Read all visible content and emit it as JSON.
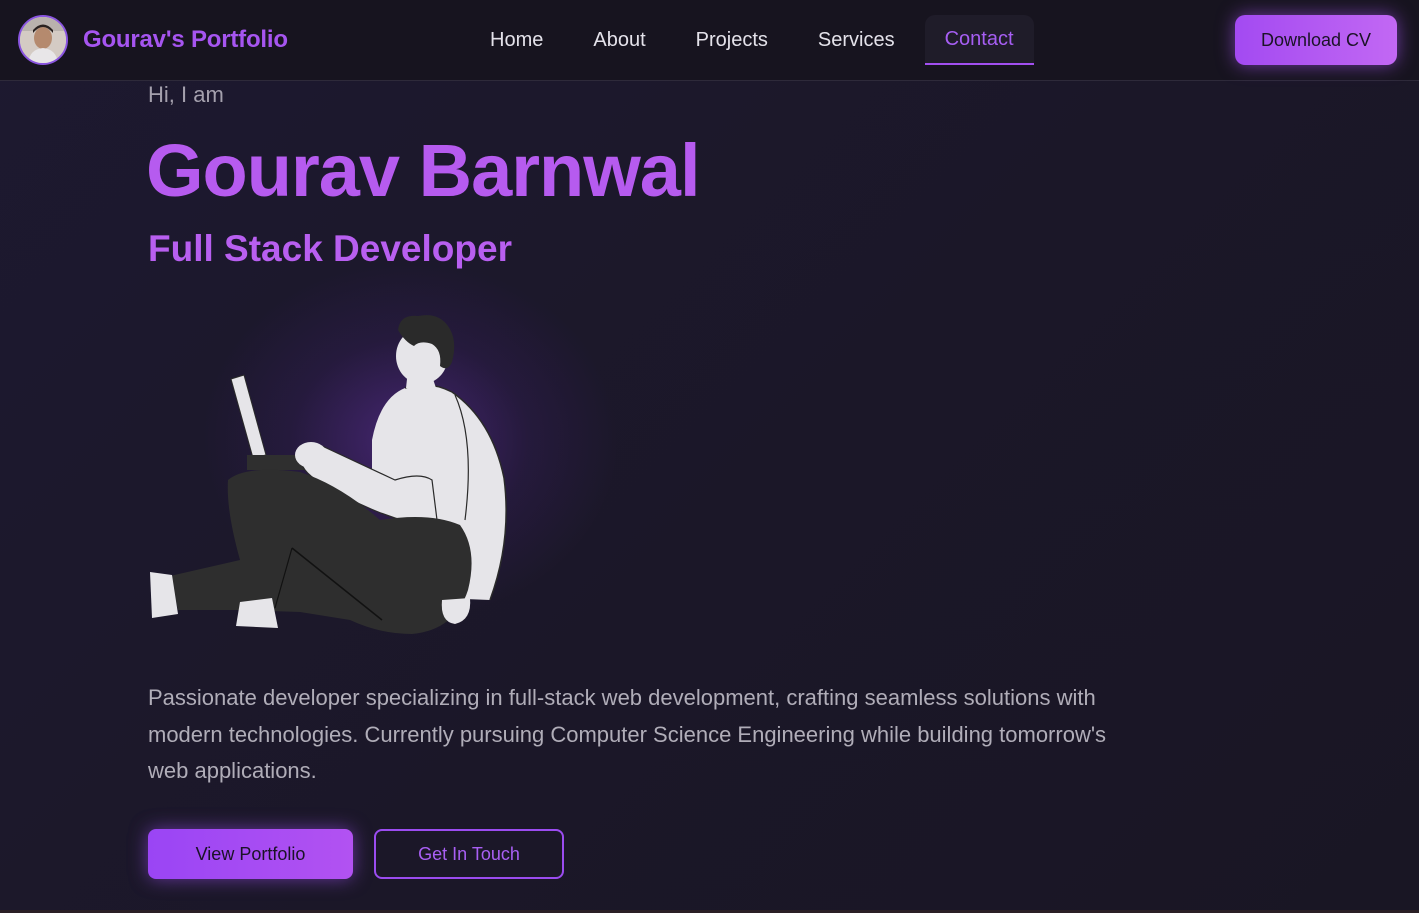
{
  "navbar": {
    "brand_name": "Gourav's Portfolio",
    "links": [
      "Home",
      "About",
      "Projects",
      "Services",
      "Contact"
    ],
    "active_link": "Contact",
    "download_cv_label": "Download CV"
  },
  "hero": {
    "greeting": "Hi, I am",
    "name": "Gourav Barnwal",
    "role": "Full Stack Developer",
    "description": "Passionate developer specializing in full-stack web development, crafting seamless solutions with modern technologies. Currently pursuing Computer Science Engineering while building tomorrow's web applications.",
    "primary_button": "View Portfolio",
    "secondary_button": "Get In Touch"
  },
  "icons": {
    "avatar": "profile-photo",
    "illustration": "developer-with-laptop-illustration"
  },
  "colors": {
    "accent": "#a855f7",
    "background": "#1b1728",
    "navbar_bg": "#17141f",
    "text_muted": "#b0adb8"
  }
}
